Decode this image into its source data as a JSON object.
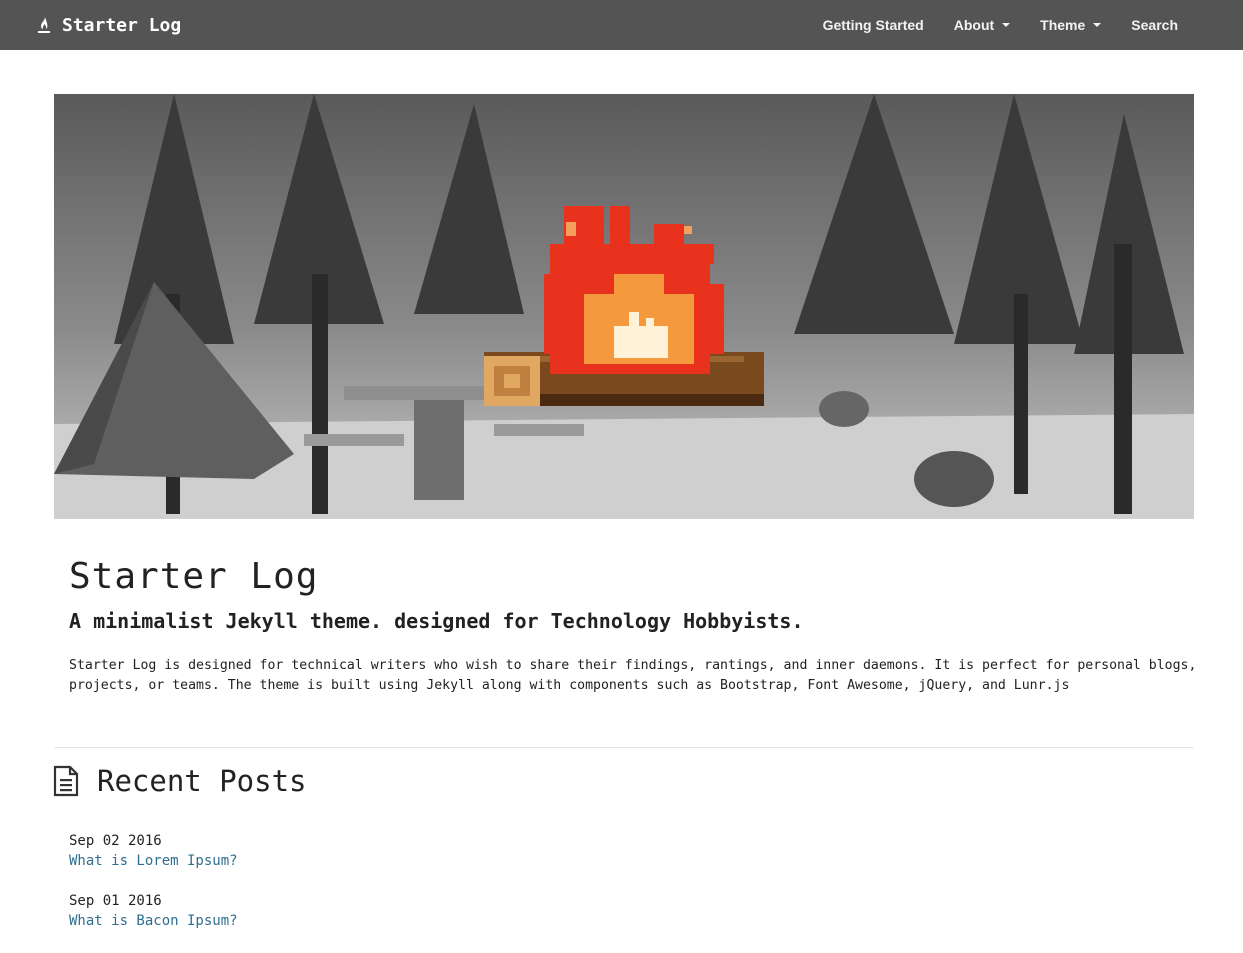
{
  "navbar": {
    "brand": "Starter Log",
    "items": [
      {
        "label": "Getting Started",
        "dropdown": false
      },
      {
        "label": "About",
        "dropdown": true
      },
      {
        "label": "Theme",
        "dropdown": true
      },
      {
        "label": "Search",
        "dropdown": false
      }
    ],
    "background": "#545454"
  },
  "hero": {
    "image": "campsite-photo-with-pixel-campfire"
  },
  "intro": {
    "title": "Starter Log",
    "subtitle": "A minimalist Jekyll theme. designed for Technology Hobbyists.",
    "description": "Starter Log is designed for technical writers who wish to share their findings, rantings, and inner daemons. It is perfect for personal blogs, projects, or teams. The theme is built using Jekyll along with components such as Bootstrap, Font Awesome, jQuery, and Lunr.js"
  },
  "recent_posts": {
    "heading": "Recent Posts",
    "icon": "file-text-icon",
    "posts": [
      {
        "date": "Sep 02 2016",
        "title": "What is Lorem Ipsum?"
      },
      {
        "date": "Sep 01 2016",
        "title": "What is Bacon Ipsum?"
      }
    ]
  },
  "colors": {
    "link": "#2f6f8f",
    "text": "#222222",
    "fire_red": "#e8321e",
    "fire_orange": "#f59a3c",
    "log_brown": "#7a4a1e"
  }
}
